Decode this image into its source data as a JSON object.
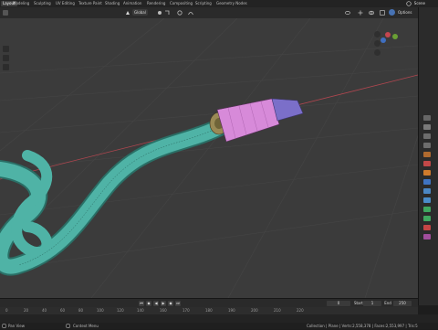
{
  "workspace_tabs": [
    {
      "label": "Layout",
      "active": true
    },
    {
      "label": "Modeling"
    },
    {
      "label": "Sculpting"
    },
    {
      "label": "UV Editing"
    },
    {
      "label": "Texture Paint"
    },
    {
      "label": "Shading"
    },
    {
      "label": "Animation"
    },
    {
      "label": "Rendering"
    },
    {
      "label": "Compositing"
    },
    {
      "label": "Scripting"
    },
    {
      "label": "Geometry Nodes"
    }
  ],
  "scene_label": "Scene",
  "viewport_header": {
    "transform_orientation": "Global",
    "options_label": "Options"
  },
  "timeline": {
    "current_frame": "0",
    "start_label": "Start",
    "start_value": "1",
    "end_label": "End",
    "end_value": "250",
    "ruler_ticks": [
      "0",
      "20",
      "40",
      "60",
      "80",
      "100",
      "120",
      "140",
      "160",
      "170",
      "180",
      "190",
      "200",
      "210",
      "220"
    ]
  },
  "status_bar": {
    "left_text": "Pan View",
    "middle_text": "Context Menu",
    "right_text": "Collection | Plane | Verts:2,558,378 | Faces:2,553,997 | Tris:5"
  },
  "colors": {
    "viewport_bg": "#3b3b3b",
    "cable_color": "#4fb3a6",
    "connector_color": "#d78ad9",
    "usb_tip_color": "#7b6fc9",
    "ring_color": "#9a8a55",
    "x_axis_color": "#b0464f"
  }
}
